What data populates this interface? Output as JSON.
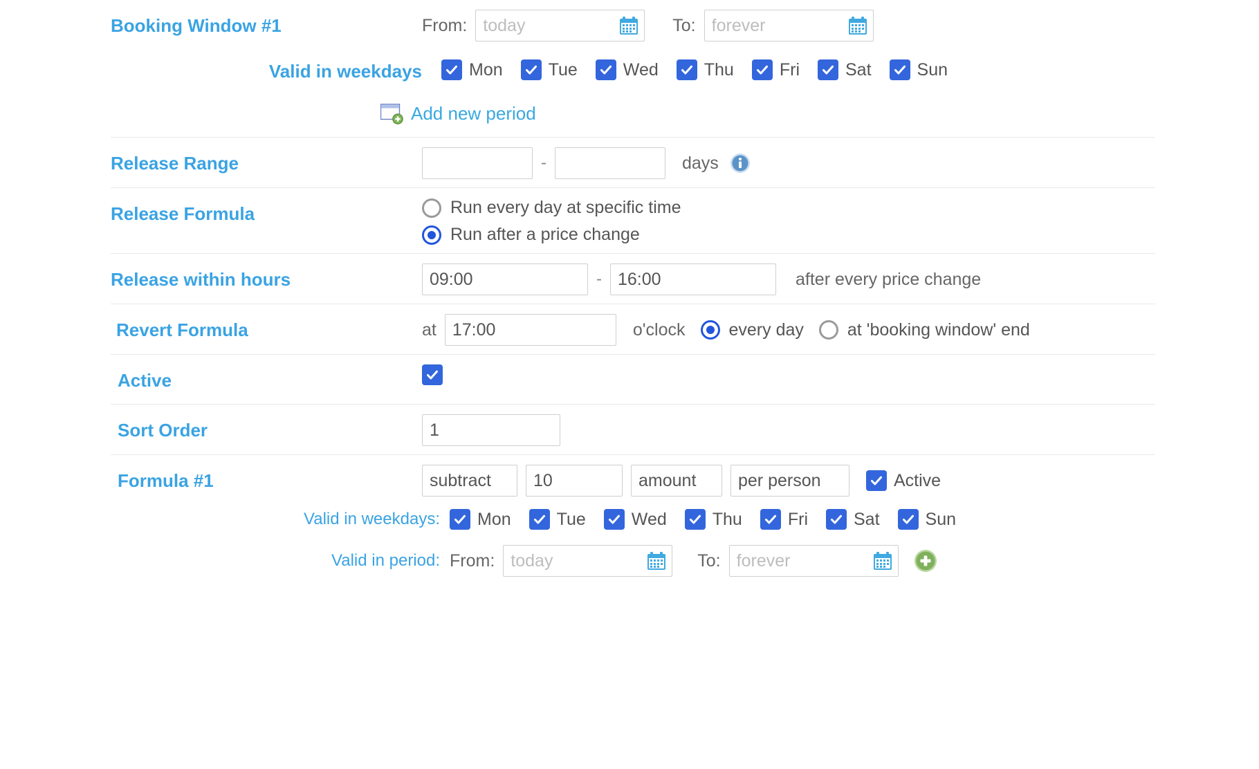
{
  "booking_window": {
    "title": "Booking Window #1",
    "from_label": "From:",
    "from_placeholder": "today",
    "to_label": "To:",
    "to_placeholder": "forever",
    "weekdays_label": "Valid in weekdays",
    "weekdays": [
      "Mon",
      "Tue",
      "Wed",
      "Thu",
      "Fri",
      "Sat",
      "Sun"
    ],
    "add_new_period": "Add new period"
  },
  "release_range": {
    "title": "Release Range",
    "from_value": "",
    "to_value": "",
    "dash": "-",
    "unit": "days"
  },
  "release_formula": {
    "title": "Release Formula",
    "options": [
      {
        "label": "Run every day at specific time",
        "selected": false
      },
      {
        "label": "Run after a price change",
        "selected": true
      }
    ]
  },
  "release_within_hours": {
    "title": "Release within hours",
    "from_value": "09:00",
    "dash": "-",
    "to_value": "16:00",
    "suffix": "after every price change"
  },
  "revert_formula": {
    "title": "Revert Formula",
    "at_label": "at",
    "time_value": "17:00",
    "oclock_label": "o'clock",
    "options": [
      {
        "label": "every day",
        "selected": true
      },
      {
        "label": "at 'booking window' end",
        "selected": false
      }
    ]
  },
  "active": {
    "title": "Active",
    "checked": true
  },
  "sort_order": {
    "title": "Sort Order",
    "value": "1"
  },
  "formula": {
    "title": "Formula #1",
    "operation": "subtract",
    "amount_value": "10",
    "amount_type": "amount",
    "scope": "per person",
    "active_label": "Active",
    "weekdays_label": "Valid in weekdays:",
    "weekdays": [
      "Mon",
      "Tue",
      "Wed",
      "Thu",
      "Fri",
      "Sat",
      "Sun"
    ],
    "period_label": "Valid in period:",
    "from_label": "From:",
    "from_placeholder": "today",
    "to_label": "To:",
    "to_placeholder": "forever"
  },
  "colors": {
    "accent": "#3aa3e3",
    "checkbox": "#3366dd",
    "radio": "#2255dd",
    "add_green": "#7db356",
    "text": "#555555",
    "border": "#cfcfcf"
  }
}
